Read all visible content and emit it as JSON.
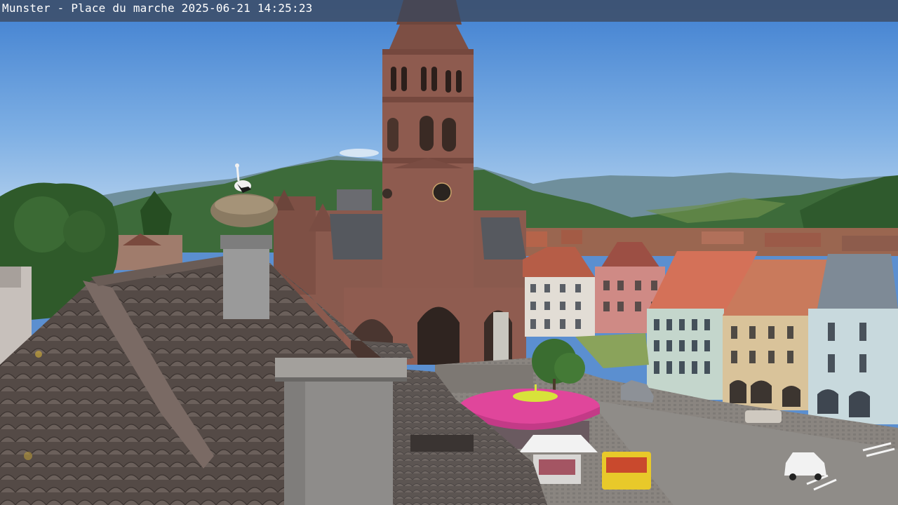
{
  "overlay": {
    "location": "Munster - Place du marche",
    "date": "2025-06-21",
    "time": "14:25:23"
  },
  "colors": {
    "sky_top": "#4d86d1",
    "sky_bottom": "#a9c8ea",
    "mountains": "#3c6a3c",
    "church": "#8a5a4e",
    "roof_tiles": "#5e5450",
    "umbrella": "#e0469b",
    "overlay_bar": "#3c485c"
  }
}
